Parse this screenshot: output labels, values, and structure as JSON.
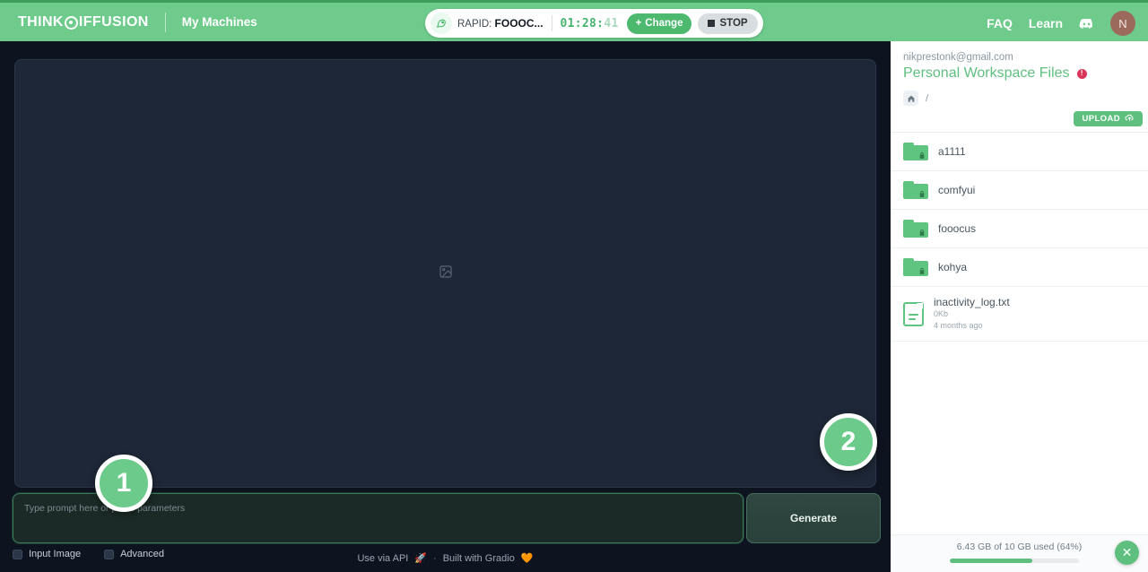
{
  "header": {
    "brand_part1": "THINK",
    "brand_part2": "IFFUSION",
    "nav_my_machines": "My Machines",
    "machine": {
      "rocket_icon": "rocket-icon",
      "label_prefix": "RAPID: ",
      "label_name": "FOOOC...",
      "timer_hours": "01:28:",
      "timer_seconds": "41",
      "change_label": "Change",
      "stop_label": "STOP"
    },
    "faq_label": "FAQ",
    "learn_label": "Learn",
    "discord_icon": "discord-icon",
    "avatar_initial": "N"
  },
  "app": {
    "canvas_placeholder_icon": "image-placeholder-icon",
    "prompt_placeholder": "Type prompt here or paste parameters",
    "prompt_value": "",
    "generate_label": "Generate",
    "checkboxes": [
      {
        "label": "Input Image",
        "checked": false
      },
      {
        "label": "Advanced",
        "checked": false
      }
    ],
    "footer": {
      "api_label": "Use via API",
      "api_icon": "rocket-icon",
      "separator": "·",
      "gradio_label": "Built with Gradio",
      "gradio_icon": "gradio-heart-icon"
    },
    "callouts": [
      {
        "number": "1"
      },
      {
        "number": "2"
      }
    ]
  },
  "files_panel": {
    "email": "nikprestonk@gmail.com",
    "title": "Personal Workspace Files",
    "info_badge": "!",
    "breadcrumb_home_icon": "home-icon",
    "breadcrumb_path": "/",
    "upload_label": "UPLOAD",
    "upload_icon": "cloud-upload-icon",
    "items": [
      {
        "name": "a1111",
        "type": "folder",
        "locked": true,
        "size": "",
        "modified": ""
      },
      {
        "name": "comfyui",
        "type": "folder",
        "locked": true,
        "size": "",
        "modified": ""
      },
      {
        "name": "fooocus",
        "type": "folder",
        "locked": true,
        "size": "",
        "modified": ""
      },
      {
        "name": "kohya",
        "type": "folder",
        "locked": true,
        "size": "",
        "modified": ""
      },
      {
        "name": "inactivity_log.txt",
        "type": "file",
        "locked": false,
        "size": "0Kb",
        "modified": "4 months ago"
      }
    ],
    "storage_text": "6.43 GB of 10 GB used (64%)",
    "storage_percent": 64,
    "close_icon": "close-icon"
  },
  "colors": {
    "brand_green": "#6ecb8b",
    "accent_green": "#5ebf7f",
    "timer_green": "#46b46e",
    "danger_red": "#d9365a",
    "app_bg": "#0e1320",
    "canvas_bg": "#1e2737"
  }
}
